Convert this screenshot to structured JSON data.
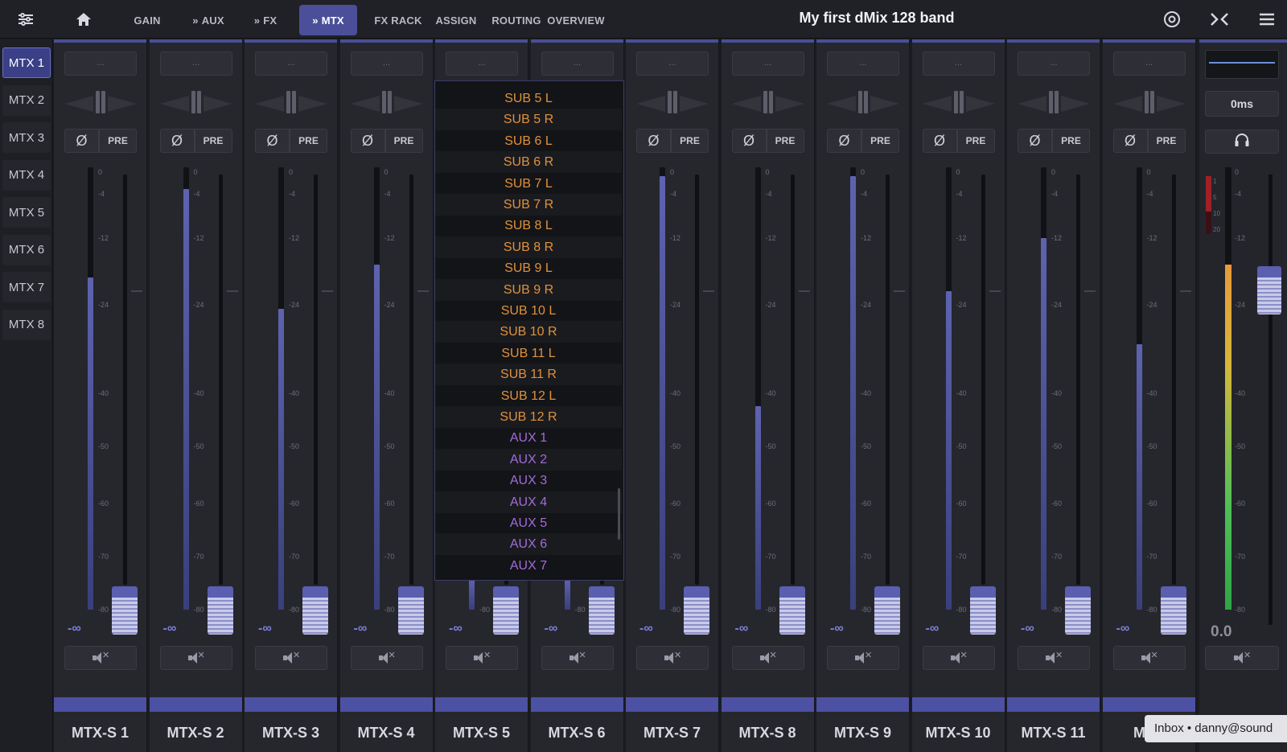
{
  "app": {
    "title": "My first dMix 128 band"
  },
  "topbar": {
    "tabs": [
      {
        "label": "GAIN",
        "prefix": ""
      },
      {
        "label": "AUX",
        "prefix": "»"
      },
      {
        "label": "FX",
        "prefix": "»"
      },
      {
        "label": "MTX",
        "prefix": "»",
        "active": true
      },
      {
        "label": "FX RACK",
        "prefix": ""
      },
      {
        "label": "ASSIGN",
        "prefix": ""
      },
      {
        "label": "ROUTING",
        "prefix": ""
      },
      {
        "label": "OVERVIEW",
        "prefix": ""
      }
    ],
    "icons": [
      "sliders-icon",
      "home-icon",
      "settings-circle-icon",
      "collapse-arrows-icon",
      "hamburger-menu-icon"
    ]
  },
  "sidebar": {
    "items": [
      {
        "label": "MTX 1",
        "active": true
      },
      {
        "label": "MTX 2"
      },
      {
        "label": "MTX 3"
      },
      {
        "label": "MTX 4"
      },
      {
        "label": "MTX 5"
      },
      {
        "label": "MTX 6"
      },
      {
        "label": "MTX 7"
      },
      {
        "label": "MTX 8"
      }
    ]
  },
  "strip_common": {
    "dots": "...",
    "phase": "Ø",
    "pre": "PRE",
    "neg_inf": "-∞",
    "scale": [
      "0",
      "-4",
      "-12",
      "-24",
      "-40",
      "-50",
      "-60",
      "-70",
      "-80"
    ]
  },
  "strips": [
    {
      "name": "MTX-S 1",
      "level": 0.75
    },
    {
      "name": "MTX-S 2",
      "level": 0.95
    },
    {
      "name": "MTX-S 3",
      "level": 0.68
    },
    {
      "name": "MTX-S 4",
      "level": 0.78
    },
    {
      "name": "MTX-S 5",
      "level": 0.07
    },
    {
      "name": "MTX-S 6",
      "level": 0.07
    },
    {
      "name": "MTX-S 7",
      "level": 0.98
    },
    {
      "name": "MTX-S 8",
      "level": 0.46
    },
    {
      "name": "MTX-S 9",
      "level": 0.98
    },
    {
      "name": "MTX-S 10",
      "level": 0.72
    },
    {
      "name": "MTX-S 11",
      "level": 0.84
    },
    {
      "name": "MTX",
      "level": 0.6
    }
  ],
  "dropdown": {
    "items": [
      {
        "label": "SUB 5 L",
        "kind": "sub"
      },
      {
        "label": "SUB 5 R",
        "kind": "sub"
      },
      {
        "label": "SUB 6 L",
        "kind": "sub"
      },
      {
        "label": "SUB 6 R",
        "kind": "sub"
      },
      {
        "label": "SUB 7 L",
        "kind": "sub"
      },
      {
        "label": "SUB 7 R",
        "kind": "sub"
      },
      {
        "label": "SUB 8 L",
        "kind": "sub"
      },
      {
        "label": "SUB 8 R",
        "kind": "sub"
      },
      {
        "label": "SUB 9 L",
        "kind": "sub"
      },
      {
        "label": "SUB 9 R",
        "kind": "sub"
      },
      {
        "label": "SUB 10 L",
        "kind": "sub"
      },
      {
        "label": "SUB 10 R",
        "kind": "sub"
      },
      {
        "label": "SUB 11 L",
        "kind": "sub"
      },
      {
        "label": "SUB 11 R",
        "kind": "sub"
      },
      {
        "label": "SUB 12 L",
        "kind": "sub"
      },
      {
        "label": "SUB 12 R",
        "kind": "sub"
      },
      {
        "label": "AUX 1",
        "kind": "aux"
      },
      {
        "label": "AUX 2",
        "kind": "aux"
      },
      {
        "label": "AUX 3",
        "kind": "aux"
      },
      {
        "label": "AUX 4",
        "kind": "aux"
      },
      {
        "label": "AUX 5",
        "kind": "aux"
      },
      {
        "label": "AUX 6",
        "kind": "aux"
      },
      {
        "label": "AUX 7",
        "kind": "aux"
      }
    ]
  },
  "master": {
    "delay": "0ms",
    "value": "0.0",
    "clip_labels": [
      "1",
      "5",
      "10",
      "20"
    ],
    "level": 0.78
  },
  "notification": {
    "text": "Inbox • danny@sound"
  },
  "colors": {
    "accent": "#4b4f9a",
    "sub": "#e0913c",
    "aux": "#a26bdc"
  }
}
